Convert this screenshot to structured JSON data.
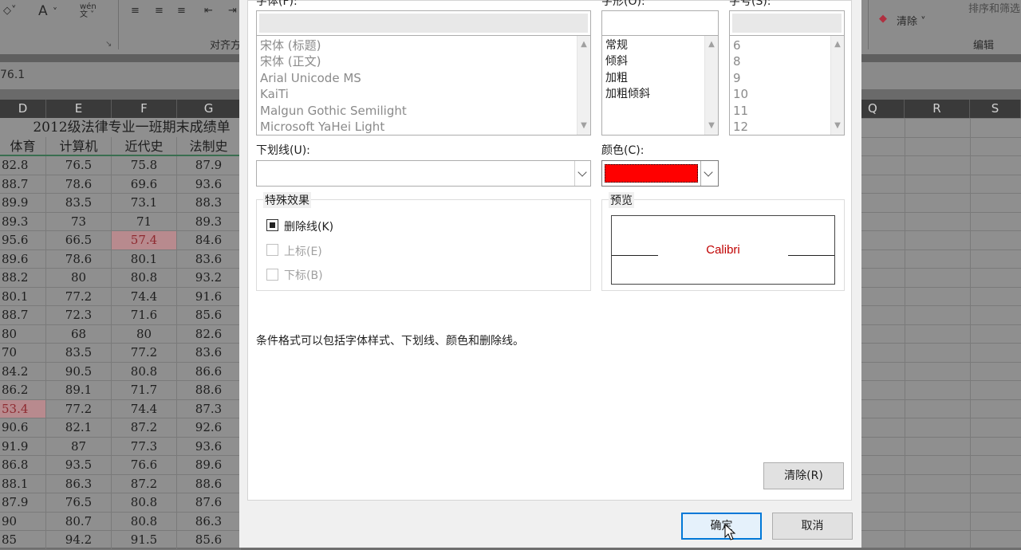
{
  "ribbon": {
    "font_color_label": "A",
    "wen_label": "wén\n文",
    "align_group": "对齐方",
    "clear_label": "清除",
    "sort_label": "排序和筛选",
    "edit_group": "编辑"
  },
  "formula_value": "76.1",
  "columns": [
    "D",
    "E",
    "F",
    "G",
    "Q",
    "R",
    "S"
  ],
  "sheet": {
    "title": "2012级法律专业一班期末成绩单",
    "headers": [
      "体育",
      "计算机",
      "近代史",
      "法制史"
    ],
    "rows": [
      [
        "82.8",
        "76.5",
        "75.8",
        "87.9"
      ],
      [
        "88.7",
        "78.6",
        "69.6",
        "93.6"
      ],
      [
        "89.9",
        "83.5",
        "73.1",
        "88.3"
      ],
      [
        "89.3",
        "73",
        "71",
        "89.3"
      ],
      [
        "95.6",
        "66.5",
        "57.4",
        "84.6"
      ],
      [
        "89.6",
        "78.6",
        "80.1",
        "83.6"
      ],
      [
        "88.2",
        "80",
        "80.8",
        "93.2"
      ],
      [
        "80.1",
        "77.2",
        "74.4",
        "91.6"
      ],
      [
        "88.7",
        "72.3",
        "71.6",
        "85.6"
      ],
      [
        "80",
        "68",
        "80",
        "82.6"
      ],
      [
        "70",
        "83.5",
        "77.2",
        "83.6"
      ],
      [
        "84.2",
        "90.5",
        "80.8",
        "86.6"
      ],
      [
        "86.2",
        "89.1",
        "71.7",
        "88.6"
      ],
      [
        "53.4",
        "77.2",
        "74.4",
        "87.3"
      ],
      [
        "90.6",
        "82.1",
        "87.2",
        "92.6"
      ],
      [
        "91.9",
        "87",
        "77.3",
        "93.6"
      ],
      [
        "86.8",
        "93.5",
        "76.6",
        "89.6"
      ],
      [
        "88.1",
        "86.3",
        "87.2",
        "88.6"
      ],
      [
        "87.9",
        "76.5",
        "80.8",
        "87.6"
      ],
      [
        "90",
        "80.7",
        "80.8",
        "86.3"
      ],
      [
        "85",
        "94.2",
        "91.5",
        "85.6"
      ]
    ],
    "highlight_color": "#b88a8e"
  },
  "dialog": {
    "font_label": "字体(F):",
    "style_label": "字形(O):",
    "size_label": "字号(S):",
    "fonts": [
      "宋体 (标题)",
      "宋体 (正文)",
      "Arial Unicode MS",
      "KaiTi",
      "Malgun Gothic Semilight",
      "Microsoft YaHei Light"
    ],
    "styles": [
      "常规",
      "倾斜",
      "加粗",
      "加粗倾斜"
    ],
    "sizes": [
      "6",
      "8",
      "9",
      "10",
      "11",
      "12"
    ],
    "underline_label": "下划线(U):",
    "underline_value": "",
    "color_label": "颜色(C):",
    "color_value": "#ff0000",
    "effects_label": "特殊效果",
    "strikethrough_label": "删除线(K)",
    "superscript_label": "上标(E)",
    "subscript_label": "下标(B)",
    "preview_label": "预览",
    "preview_text": "Calibri",
    "info": "条件格式可以包括字体样式、下划线、颜色和删除线。",
    "clear_button": "清除(R)",
    "ok_button": "确定",
    "cancel_button": "取消"
  }
}
